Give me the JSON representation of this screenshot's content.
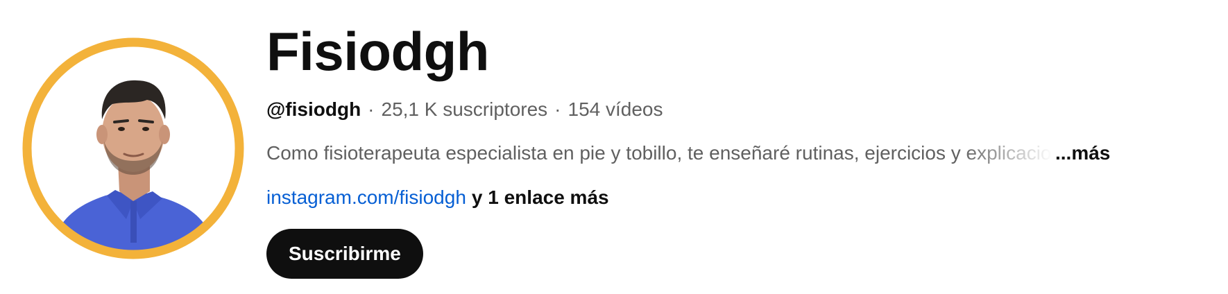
{
  "channel": {
    "name": "Fisiodgh",
    "handle": "@fisiodgh",
    "subscribers": "25,1 K suscriptores",
    "videos": "154 vídeos",
    "separator": "·",
    "description": "Como fisioterapeuta especialista en pie y tobillo, te enseñaré rutinas, ejercicios y explicaciones",
    "description_more": "...más",
    "link": "instagram.com/fisiodgh",
    "more_links": "y 1 enlace más",
    "subscribe_label": "Suscribirme"
  },
  "avatar": {
    "icon": "person-avatar-photo",
    "ring_color": "#F3B23A",
    "shirt_color": "#4A63D6"
  },
  "colors": {
    "primary_text": "#0f0f0f",
    "secondary_text": "#606060",
    "link": "#065fd4",
    "button_bg": "#0f0f0f",
    "button_text": "#ffffff"
  }
}
